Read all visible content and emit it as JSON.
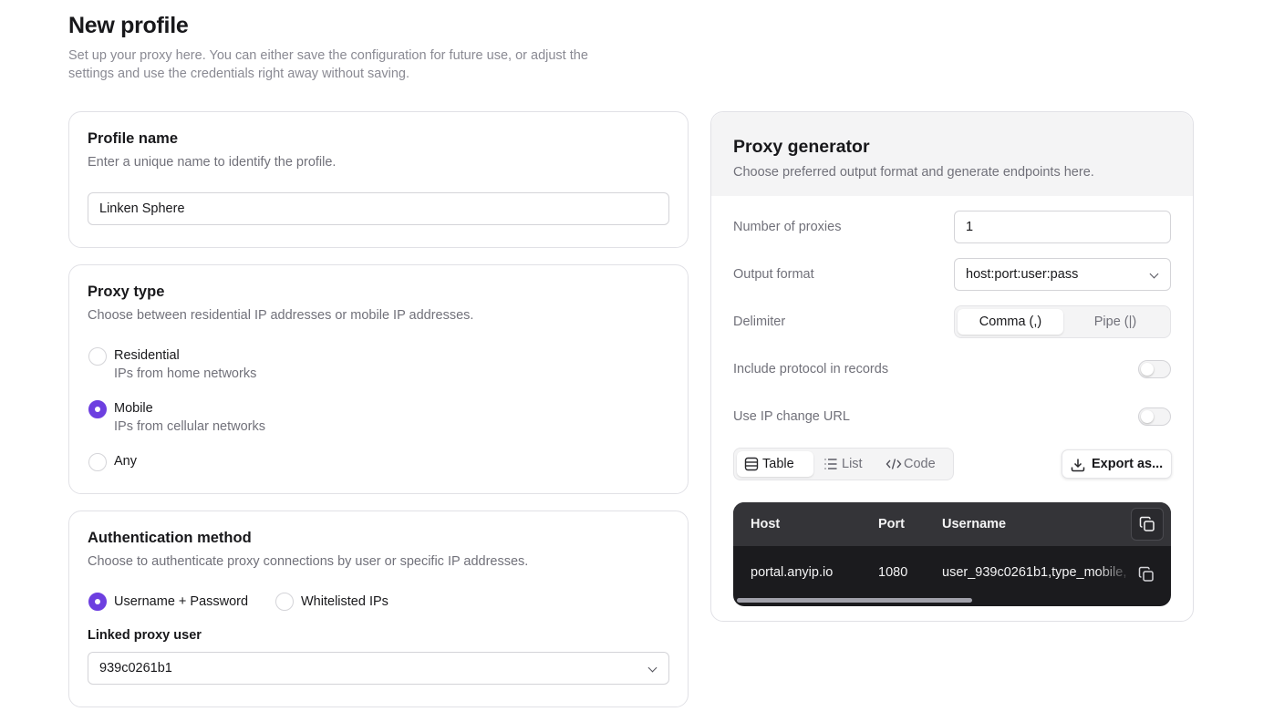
{
  "header": {
    "title": "New profile",
    "description": "Set up your proxy here. You can either save the configuration for future use, or adjust the settings and use the credentials right away without saving."
  },
  "profile_name": {
    "title": "Profile name",
    "description": "Enter a unique name to identify the profile.",
    "value": "Linken Sphere"
  },
  "proxy_type": {
    "title": "Proxy type",
    "description": "Choose between residential IP addresses or mobile IP addresses.",
    "options": [
      {
        "label": "Residential",
        "sub": "IPs from home networks",
        "selected": false
      },
      {
        "label": "Mobile",
        "sub": "IPs from cellular networks",
        "selected": true
      },
      {
        "label": "Any",
        "sub": "",
        "selected": false
      }
    ]
  },
  "auth": {
    "title": "Authentication method",
    "description": "Choose to authenticate proxy connections by user or specific IP addresses.",
    "options": [
      {
        "label": "Username + Password",
        "selected": true
      },
      {
        "label": "Whitelisted IPs",
        "selected": false
      }
    ],
    "linked_user_label": "Linked proxy user",
    "linked_user_value": "939c0261b1"
  },
  "generator": {
    "title": "Proxy generator",
    "description": "Choose preferred output format and generate endpoints here.",
    "number_label": "Number of proxies",
    "number_value": "1",
    "format_label": "Output format",
    "format_value": "host:port:user:pass",
    "delimiter_label": "Delimiter",
    "delimiter_options": [
      "Comma (,)",
      "Pipe (|)"
    ],
    "delimiter_selected": "Comma (,)",
    "protocol_label": "Include protocol in records",
    "protocol_on": false,
    "ipchange_label": "Use IP change URL",
    "ipchange_on": false,
    "view_tabs": [
      "Table",
      "List",
      "Code"
    ],
    "view_selected": "Table",
    "export_label": "Export as...",
    "table": {
      "columns": [
        "Host",
        "Port",
        "Username"
      ],
      "rows": [
        [
          "portal.anyip.io",
          "1080",
          "user_939c0261b1,type_mobile,"
        ]
      ]
    }
  },
  "colors": {
    "accent": "#6d3fe0",
    "table_bg": "#1b1b1e",
    "table_header": "#343438"
  },
  "icons": [
    "chevron-down-icon",
    "table-icon",
    "list-icon",
    "code-icon",
    "download-icon",
    "copy-icon"
  ]
}
